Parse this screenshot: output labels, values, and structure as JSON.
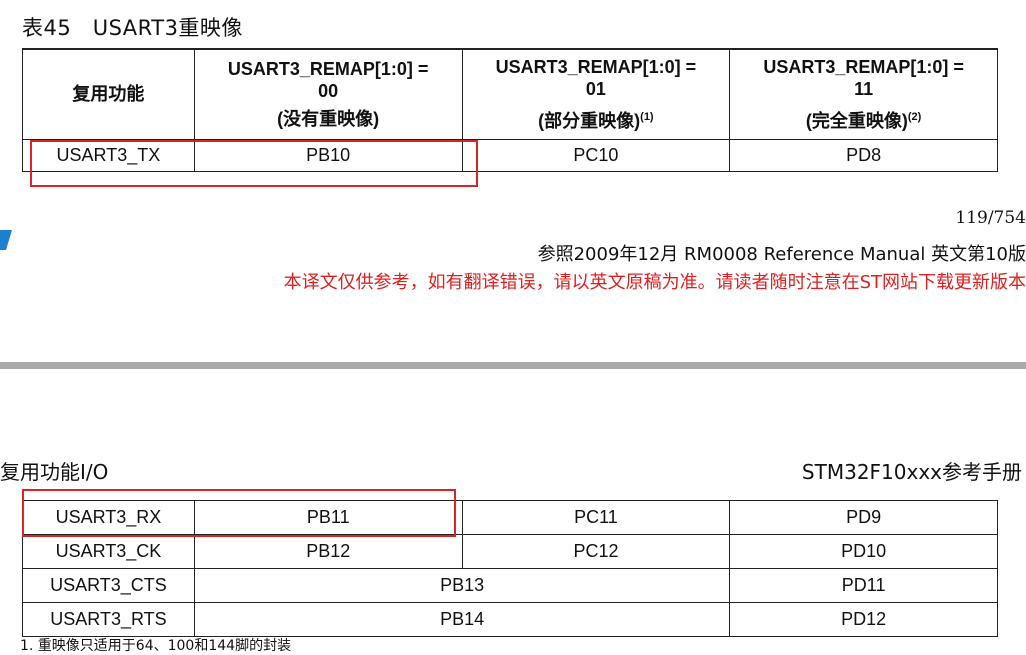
{
  "caption": "表45　USART3重映像",
  "table1": {
    "headers": [
      {
        "label": "复用功能",
        "value": "",
        "sub": "",
        "note": ""
      },
      {
        "label": "USART3_REMAP[1:0] =",
        "value": "00",
        "sub": "(没有重映像)",
        "note": ""
      },
      {
        "label": "USART3_REMAP[1:0] =",
        "value": "01",
        "sub": "(部分重映像)",
        "note": "(1)"
      },
      {
        "label": "USART3_REMAP[1:0] =",
        "value": "11",
        "sub": "(完全重映像)",
        "note": "(2)"
      }
    ],
    "rows": [
      [
        "USART3_TX",
        "PB10",
        "PC10",
        "PD8"
      ]
    ]
  },
  "page_number": "119/754",
  "reference_line": "参照2009年12月 RM0008 Reference Manual 英文第10版",
  "notice": "本译文仅供参考，如有翻译错误，请以英文原稿为准。请读者随时注意在ST网站下载更新版本",
  "section_title": "复用功能I/O",
  "manual_title": "STM32F10xxx参考手册",
  "table2": {
    "rows": [
      [
        "USART3_RX",
        "PB11",
        "PC11",
        "PD9"
      ],
      [
        "USART3_CK",
        "PB12",
        "PC12",
        "PD10"
      ],
      [
        "USART3_CTS",
        "PB13",
        "PD11"
      ],
      [
        "USART3_RTS",
        "PB14",
        "PD12"
      ]
    ]
  },
  "footnote": "1. 重映像只适用于64、100和144脚的封装",
  "colors": {
    "highlight": "#d9252a",
    "notice": "#e02020",
    "logo": "#1d7fd0"
  }
}
